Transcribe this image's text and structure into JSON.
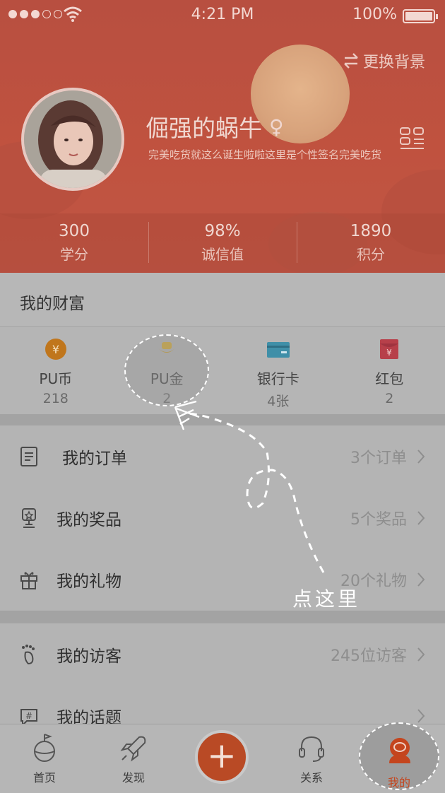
{
  "status_bar": {
    "time": "4:21 PM",
    "battery": "100%"
  },
  "header": {
    "change_bg_label": "更换背景",
    "username": "倔强的蜗牛",
    "gender_symbol": "♀",
    "signature": "完美吃货就这么诞生啦啦这里是个性签名完美吃货"
  },
  "stats": [
    {
      "value": "300",
      "label": "学分"
    },
    {
      "value": "98%",
      "label": "诚信值"
    },
    {
      "value": "1890",
      "label": "积分"
    }
  ],
  "wealth": {
    "title": "我的财富",
    "items": [
      {
        "label": "PU币",
        "value": "218",
        "icon": "coin-icon"
      },
      {
        "label": "PU金",
        "value": "2",
        "icon": "gold-ingot-icon"
      },
      {
        "label": "银行卡",
        "value": "4张",
        "icon": "bank-card-icon"
      },
      {
        "label": "红包",
        "value": "2",
        "icon": "red-envelope-icon"
      }
    ]
  },
  "list1": [
    {
      "label": "我的订单",
      "value": "3个订单",
      "icon": "order-icon"
    },
    {
      "label": "我的奖品",
      "value": "5个奖品",
      "icon": "trophy-icon"
    },
    {
      "label": "我的礼物",
      "value": "20个礼物",
      "icon": "gift-icon"
    }
  ],
  "list2": [
    {
      "label": "我的访客",
      "value": "245位访客",
      "icon": "footprint-icon"
    },
    {
      "label": "我的话题",
      "value": "",
      "icon": "topic-icon"
    }
  ],
  "tabbar": [
    {
      "label": "首页",
      "icon": "home-globe-icon"
    },
    {
      "label": "发现",
      "icon": "rocket-icon"
    },
    {
      "label": "",
      "icon": "plus-icon"
    },
    {
      "label": "关系",
      "icon": "headset-icon"
    },
    {
      "label": "我的",
      "icon": "astronaut-icon"
    }
  ],
  "annotation": {
    "tip": "点这里"
  },
  "colors": {
    "header": "#bf5442",
    "accent": "#b94a25",
    "overlay_gray": "#b4b4b4"
  }
}
